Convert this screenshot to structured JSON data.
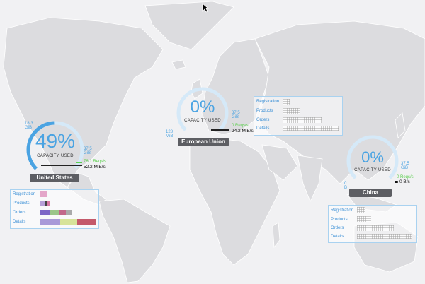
{
  "colors": {
    "accent": "#4aa3e2",
    "green": "#5ccf4e",
    "badge": "#5d5e63",
    "land": "#dcdcdf",
    "ocean": "#f1f1f3",
    "panel_border": "#a9d2f0"
  },
  "cursor_icon": "arrow-cursor-icon",
  "regions": {
    "us": {
      "name": "United States",
      "percent": "49%",
      "capacity_label": "CAPACITY USED",
      "size_top": "18.3 GiB",
      "size_right": "37.5 GiB",
      "rate_green": "76.1 Reqs/s",
      "rate_black": "52.2 MiB/s",
      "used_fraction": 0.49,
      "rows": [
        "Registration",
        "Products",
        "Orders",
        "Details"
      ]
    },
    "eu": {
      "name": "European Union",
      "percent": "0%",
      "capacity_label": "CAPACITY USED",
      "size_left": "128 MiB",
      "size_right": "37.5 GiB",
      "rate_green": "0 Reqs/s",
      "rate_black": "24.2 MiB/s",
      "used_fraction": 0,
      "rows": [
        "Registration",
        "Products",
        "Orders",
        "Details"
      ]
    },
    "cn": {
      "name": "China",
      "percent": "0%",
      "capacity_label": "CAPACITY USED",
      "size_left": "0 B",
      "size_right": "37.5 GiB",
      "rate_green": "0 Reqs/s",
      "rate_black": "0 B/s",
      "used_fraction": 0,
      "rows": [
        "Registration",
        "Products",
        "Orders",
        "Details"
      ]
    }
  }
}
